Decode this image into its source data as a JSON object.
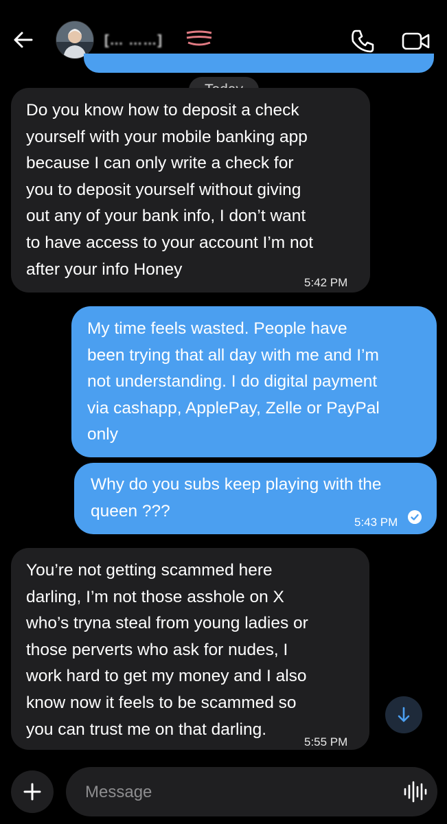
{
  "header": {
    "contact_name": "[… ……]",
    "back_icon": "arrow-left-icon",
    "call_icon": "phone-icon",
    "video_icon": "video-camera-icon"
  },
  "date_separator": "Today",
  "messages": [
    {
      "direction": "incoming",
      "text": "Do you know how to deposit a check\nyourself with  your mobile banking app\nbecause I can only write a check for\nyou to deposit yourself without giving\nout any of your bank info, I don’t want\nto have access to your account I’m not\nafter your info Honey",
      "time": "5:42 PM"
    },
    {
      "direction": "outgoing",
      "text": "My time feels wasted. People have\nbeen trying that all day with me and I’m\nnot understanding. I do digital payment\nvia cashapp, ApplePay, Zelle or PayPal\nonly",
      "time": ""
    },
    {
      "direction": "outgoing",
      "text": "Why do you subs keep playing with the\nqueen ???",
      "time": "5:43 PM",
      "status": "read-check-icon"
    },
    {
      "direction": "incoming",
      "text": "You’re not getting scammed here\ndarling, I’m not those asshole on X\nwho’s tryna steal from young ladies or\nthose perverts who ask for nudes, I\nwork hard to get my money and I also\nknow now it feels to be scammed so\nyou can trust me on that darling.",
      "time": "5:55 PM"
    }
  ],
  "composer": {
    "placeholder": "Message",
    "add_icon": "plus-icon",
    "voice_icon": "voice-waveform-icon"
  },
  "colors": {
    "background": "#000000",
    "incoming_bubble": "#1f1f21",
    "outgoing_bubble": "#4b9ff0",
    "scroll_button": "#1e2a3a",
    "accent": "#4b9ff0"
  }
}
